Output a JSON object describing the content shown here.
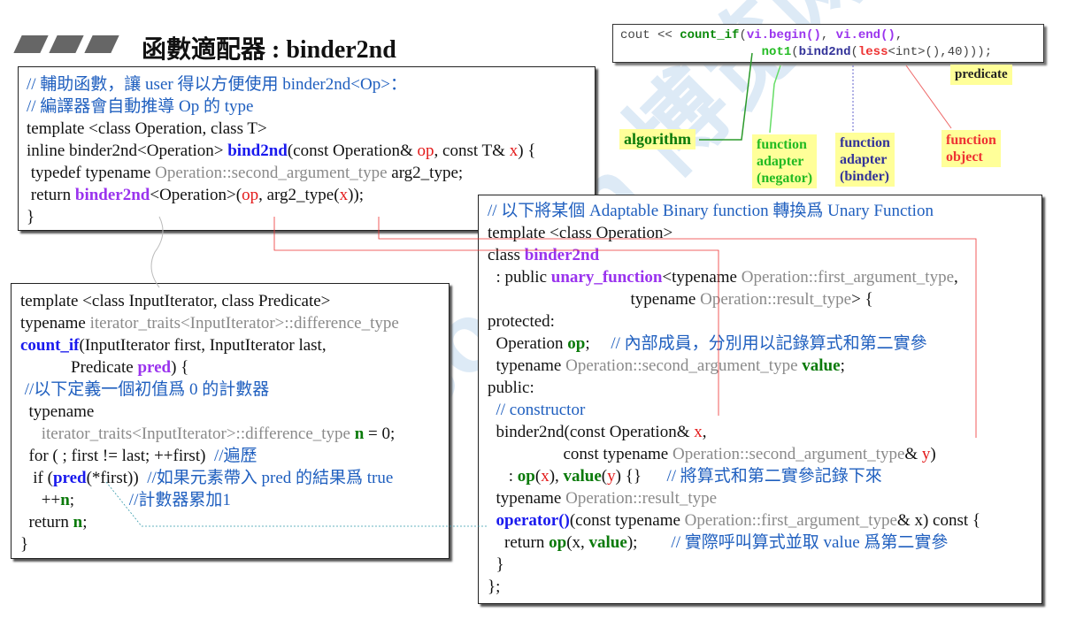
{
  "title": "函數適配器 : binder2nd",
  "watermark": "Boolan 博览网",
  "top_code": [
    [
      [
        "cout << ",
        ""
      ],
      [
        "count_if",
        "tk"
      ],
      [
        "(",
        ""
      ],
      [
        "vi.begin()",
        "tp"
      ],
      [
        ", ",
        ""
      ],
      [
        "vi.end()",
        "tp"
      ],
      [
        ",",
        ""
      ]
    ],
    [
      [
        "                   ",
        ""
      ],
      [
        "not1",
        "tg"
      ],
      [
        "(",
        ""
      ],
      [
        "bind2nd",
        "tb"
      ],
      [
        "(",
        ""
      ],
      [
        "less",
        "tr"
      ],
      [
        "<int>(),40)));",
        ""
      ]
    ]
  ],
  "labels": {
    "predicate": "predicate",
    "algorithm": "algorithm",
    "negator": [
      "function",
      "adapter",
      "(negator)"
    ],
    "binder": [
      "function",
      "adapter",
      "(binder)"
    ],
    "function_object": [
      "function",
      "object"
    ]
  },
  "colors": {
    "comment": "#1f5fbf",
    "keyword_blue": "#1a1aee",
    "purple": "#9a33ee",
    "red": "#e31a1a",
    "green": "#0a7a0a",
    "label_bg": "#ffff99"
  },
  "box1": [
    [
      [
        "// 輔助函數，讓 user 得以方便使用 binder2nd<Op>：",
        "c"
      ]
    ],
    [
      [
        "// 編譯器會自動推導 Op 的 type",
        "c"
      ]
    ],
    [
      [
        "template <class Operation, class T>",
        ""
      ]
    ],
    [
      [
        "inline binder2nd<Operation> ",
        ""
      ],
      [
        "bind2nd",
        "b"
      ],
      [
        "(const Operation& ",
        ""
      ],
      [
        "op",
        "r"
      ],
      [
        ", const T& ",
        ""
      ],
      [
        "x",
        "r"
      ],
      [
        ") {",
        ""
      ]
    ],
    [
      [
        " typedef typename ",
        ""
      ],
      [
        "Operation::second_argument_type",
        "g"
      ],
      [
        " arg2_type;",
        ""
      ]
    ],
    [
      [
        " return ",
        ""
      ],
      [
        "binder2nd",
        "p"
      ],
      [
        "<Operation>(",
        ""
      ],
      [
        "op",
        "r"
      ],
      [
        ", arg2_type(",
        ""
      ],
      [
        "x",
        "r"
      ],
      [
        "));",
        ""
      ]
    ],
    [
      [
        "}",
        ""
      ]
    ]
  ],
  "box3": [
    [
      [
        "template <class InputIterator, class Predicate>",
        ""
      ]
    ],
    [
      [
        "typename ",
        ""
      ],
      [
        "iterator_traits<InputIterator>::difference_type",
        "g"
      ]
    ],
    [
      [
        "count_if",
        "b"
      ],
      [
        "(InputIterator first, InputIterator last,",
        ""
      ]
    ],
    [
      [
        "            Predicate ",
        ""
      ],
      [
        "pred",
        "p"
      ],
      [
        ") {",
        ""
      ]
    ],
    [
      [
        " //以下定義一個初值爲 0 的計數器",
        "c"
      ]
    ],
    [
      [
        "  typename",
        ""
      ]
    ],
    [
      [
        "     ",
        ""
      ],
      [
        "iterator_traits<InputIterator>::difference_type",
        "g"
      ],
      [
        " ",
        ""
      ],
      [
        "n",
        "gr"
      ],
      [
        " = 0;",
        ""
      ]
    ],
    [
      [
        "  for ( ; first != last; ++first)  ",
        ""
      ],
      [
        "//遍歷",
        "c"
      ]
    ],
    [
      [
        "   if (",
        ""
      ],
      [
        "pred",
        "b"
      ],
      [
        "(*first))  ",
        ""
      ],
      [
        "//如果元素帶入 pred 的結果爲 true",
        "c"
      ]
    ],
    [
      [
        "     ++",
        ""
      ],
      [
        "n",
        "gr"
      ],
      [
        ";             ",
        ""
      ],
      [
        "//計數器累加1",
        "c"
      ]
    ],
    [
      [
        "  return ",
        ""
      ],
      [
        "n",
        "gr"
      ],
      [
        ";",
        ""
      ]
    ],
    [
      [
        "}",
        ""
      ]
    ]
  ],
  "box2": [
    [
      [
        "// 以下將某個 Adaptable Binary function 轉換爲 Unary Function",
        "c"
      ]
    ],
    [
      [
        "template <class Operation>",
        ""
      ]
    ],
    [
      [
        "class ",
        ""
      ],
      [
        "binder2nd",
        "p"
      ]
    ],
    [
      [
        "  : public ",
        ""
      ],
      [
        "unary_function",
        "p"
      ],
      [
        "<typename ",
        ""
      ],
      [
        "Operation::first_argument_type",
        "g"
      ],
      [
        ",",
        ""
      ]
    ],
    [
      [
        "                                  typename ",
        ""
      ],
      [
        "Operation::result_type",
        "g"
      ],
      [
        "> {",
        ""
      ]
    ],
    [
      [
        "protected:",
        ""
      ]
    ],
    [
      [
        "  Operation ",
        ""
      ],
      [
        "op",
        "gr"
      ],
      [
        ";     ",
        ""
      ],
      [
        "// 內部成員，分別用以記錄算式和第二實參",
        "c"
      ]
    ],
    [
      [
        "  typename ",
        ""
      ],
      [
        "Operation::second_argument_type",
        "g"
      ],
      [
        " ",
        ""
      ],
      [
        "value",
        "gr"
      ],
      [
        ";",
        ""
      ]
    ],
    [
      [
        "public:",
        ""
      ]
    ],
    [
      [
        "  // constructor",
        "c"
      ]
    ],
    [
      [
        "  binder2nd(const Operation& ",
        ""
      ],
      [
        "x",
        "r"
      ],
      [
        ",",
        ""
      ]
    ],
    [
      [
        "                  const typename ",
        ""
      ],
      [
        "Operation::second_argument_type",
        "g"
      ],
      [
        "& ",
        ""
      ],
      [
        "y",
        "r"
      ],
      [
        ")",
        ""
      ]
    ],
    [
      [
        "     : ",
        ""
      ],
      [
        "op",
        "gr"
      ],
      [
        "(",
        ""
      ],
      [
        "x",
        "r"
      ],
      [
        "), ",
        ""
      ],
      [
        "value",
        "gr"
      ],
      [
        "(",
        ""
      ],
      [
        "y",
        "r"
      ],
      [
        ") {}      ",
        ""
      ],
      [
        "// 將算式和第二實參記錄下來",
        "c"
      ]
    ],
    [
      [
        "  typename ",
        ""
      ],
      [
        "Operation::result_type",
        "g"
      ]
    ],
    [
      [
        "  ",
        ""
      ],
      [
        "operator()",
        "b"
      ],
      [
        "(const typename ",
        ""
      ],
      [
        "Operation::first_argument_type",
        "g"
      ],
      [
        "& x) const {",
        ""
      ]
    ],
    [
      [
        "    return ",
        ""
      ],
      [
        "op",
        "gr"
      ],
      [
        "(x, ",
        ""
      ],
      [
        "value",
        "gr"
      ],
      [
        ");        ",
        ""
      ],
      [
        "// 實際呼叫算式並取 value 爲第二實參",
        "c"
      ]
    ],
    [
      [
        "  }",
        ""
      ]
    ],
    [
      [
        "};",
        ""
      ]
    ]
  ]
}
